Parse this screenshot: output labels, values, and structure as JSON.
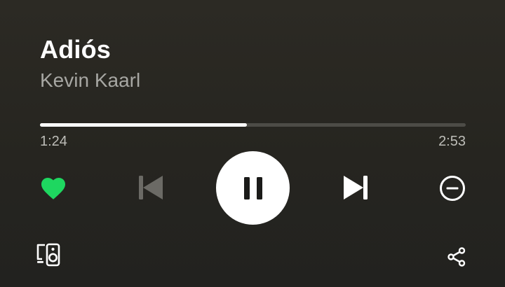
{
  "track": {
    "title": "Adiós",
    "artist": "Kevin Kaarl"
  },
  "playback": {
    "elapsed": "1:24",
    "duration": "2:53",
    "progress_fraction": 0.486,
    "state": "playing",
    "liked": true
  },
  "icons": {
    "like": "heart-icon",
    "previous": "skip-previous-icon",
    "pause": "pause-icon",
    "next": "skip-next-icon",
    "remove": "minus-circle-icon",
    "devices": "connect-devices-icon",
    "share": "share-icon"
  },
  "colors": {
    "accent": "#1ed760",
    "text_primary": "#ffffff",
    "text_secondary": "#a7a7a3",
    "disabled": "#6b6a65",
    "progress_track": "#4d4c47"
  }
}
